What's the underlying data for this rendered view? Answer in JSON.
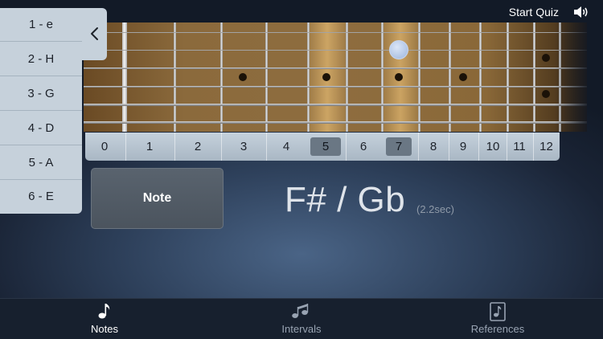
{
  "header": {
    "start_quiz_label": "Start Quiz",
    "sound_icon": "speaker-icon"
  },
  "string_panel": {
    "collapse_icon": "chevron-left-icon",
    "items": [
      {
        "label": "1 - e"
      },
      {
        "label": "2 - H"
      },
      {
        "label": "3 - G"
      },
      {
        "label": "4 - D"
      },
      {
        "label": "5 - A"
      },
      {
        "label": "6 - E"
      }
    ]
  },
  "fretboard": {
    "fret_numbers": [
      "0",
      "1",
      "2",
      "3",
      "4",
      "5",
      "6",
      "7",
      "8",
      "9",
      "10",
      "11",
      "12"
    ],
    "highlighted_frets": [
      "5",
      "7"
    ],
    "selected_position": {
      "string": "2 - H",
      "fret": "7"
    }
  },
  "main": {
    "note_button_label": "Note",
    "note_display": "F# / Gb",
    "note_time": "(2.2sec)"
  },
  "tabs": [
    {
      "label": "Notes",
      "icon": "music-note-icon",
      "active": true
    },
    {
      "label": "Intervals",
      "icon": "music-notes-icon",
      "active": false
    },
    {
      "label": "References",
      "icon": "music-document-icon",
      "active": false
    }
  ],
  "colors": {
    "tab_active": "#ffffff",
    "tab_inactive": "#98a3b2",
    "marker": "#a9c0e3",
    "panel": "#c6d1db"
  }
}
